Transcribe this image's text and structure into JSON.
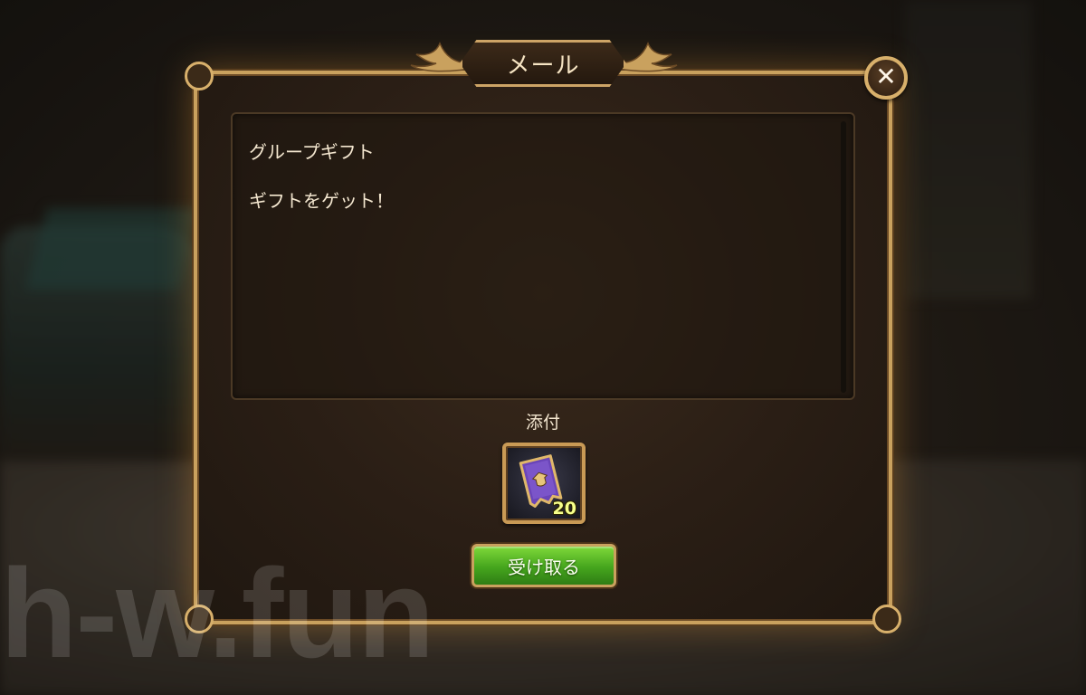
{
  "dialog": {
    "title": "メール",
    "close_icon": "close-icon"
  },
  "message": {
    "subject": "グループギフト",
    "body": "ギフトをゲット！"
  },
  "attachment": {
    "label": "添付",
    "item": {
      "icon": "skill-book-icon",
      "count": "20"
    }
  },
  "actions": {
    "claim_label": "受け取る"
  },
  "watermark": "h-w.fun",
  "colors": {
    "frame_gold": "#c9a15e",
    "claim_green": "#45a51d",
    "count_yellow": "#f6ff8a"
  }
}
